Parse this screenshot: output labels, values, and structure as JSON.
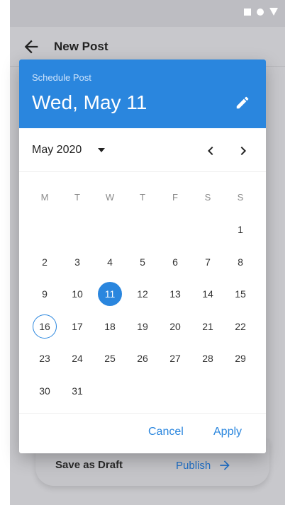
{
  "app": {
    "title": "New Post"
  },
  "status_icons": [
    "square-icon",
    "circle-icon",
    "triangle-icon"
  ],
  "dialog": {
    "overline": "Schedule Post",
    "selected_date_label": "Wed, May 11",
    "month_year": "May 2020",
    "weekdays": [
      "M",
      "T",
      "W",
      "T",
      "F",
      "S",
      "S"
    ],
    "weeks": [
      [
        "",
        "",
        "",
        "",
        "",
        "",
        "1"
      ],
      [
        "2",
        "3",
        "4",
        "5",
        "6",
        "7",
        "8"
      ],
      [
        "9",
        "10",
        "11",
        "12",
        "13",
        "14",
        "15"
      ],
      [
        "16",
        "17",
        "18",
        "19",
        "20",
        "21",
        "22"
      ],
      [
        "23",
        "24",
        "25",
        "26",
        "27",
        "28",
        "29"
      ],
      [
        "30",
        "31",
        "",
        "",
        "",
        "",
        ""
      ]
    ],
    "selected_day": "11",
    "today_day": "16",
    "cancel_label": "Cancel",
    "apply_label": "Apply"
  },
  "bottom_bar": {
    "draft_label": "Save as Draft",
    "publish_label": "Publish"
  },
  "colors": {
    "accent": "#2a86de",
    "scrim": "#c8c8cc"
  }
}
